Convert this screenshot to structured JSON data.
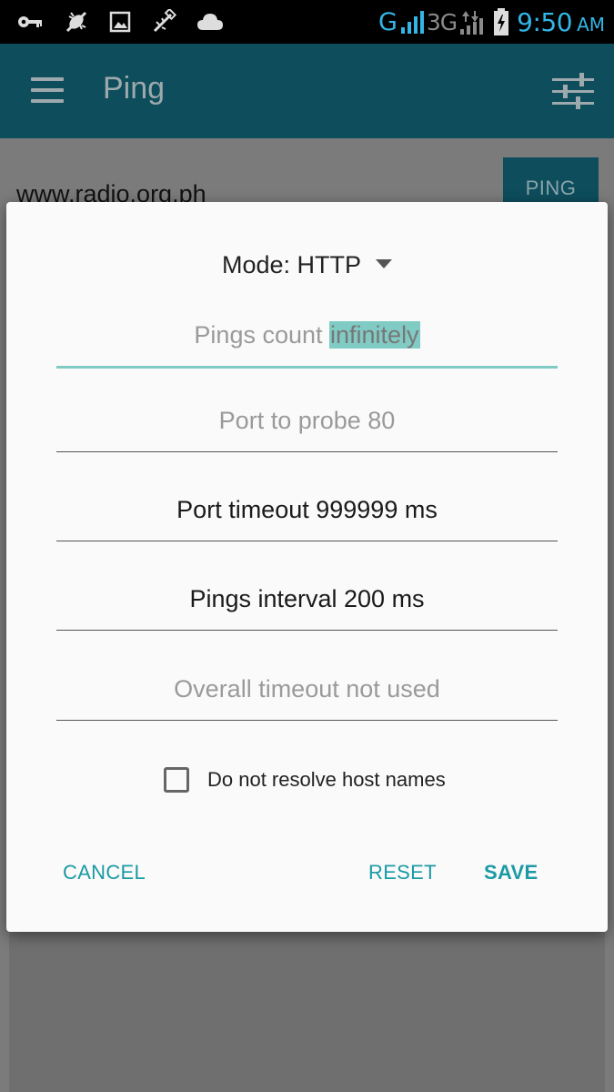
{
  "status_bar": {
    "network_g": "G",
    "network_3g": "3G",
    "time": "9:50",
    "ampm": "AM",
    "icons": [
      "key-icon",
      "usb-debug-icon",
      "image-icon",
      "usb-icon",
      "cloud-icon",
      "signal-icon",
      "data-arrows-icon",
      "battery-charging-icon"
    ]
  },
  "app_bar": {
    "title": "Ping",
    "menu_icon": "menu-icon",
    "settings_icon": "tune-icon",
    "color": "#0d4d5c"
  },
  "main": {
    "host": "www.radio.org.ph",
    "ping_button": "PING"
  },
  "dialog": {
    "mode_label": "Mode: HTTP",
    "fields": [
      {
        "hint": "Pings count",
        "value": "infinitely",
        "state": "focused-selected"
      },
      {
        "hint": "Port to probe 80",
        "value": "",
        "state": "hint"
      },
      {
        "hint": "",
        "value": "Port timeout 999999 ms",
        "state": "value"
      },
      {
        "hint": "",
        "value": "Pings interval 200 ms",
        "state": "value"
      },
      {
        "hint": "Overall timeout not used",
        "value": "",
        "state": "hint"
      }
    ],
    "checkbox_label": "Do not resolve host names",
    "checkbox_checked": false,
    "buttons": {
      "cancel": "CANCEL",
      "reset": "RESET",
      "save": "SAVE"
    },
    "accent_color": "#1b9aa4",
    "selection_color": "#80cbc4"
  }
}
